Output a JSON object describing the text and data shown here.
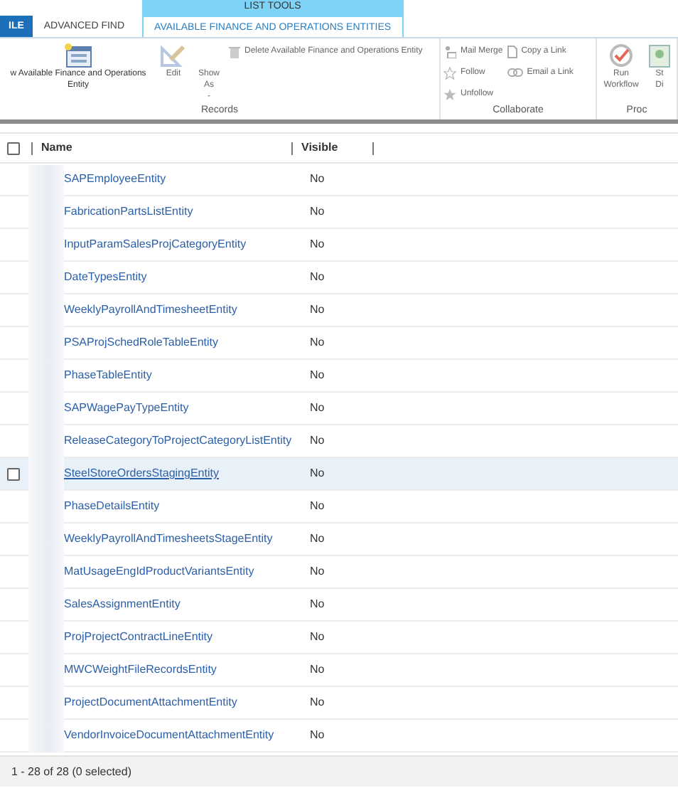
{
  "tabs": [
    {
      "label": "ILE",
      "kind": "file",
      "selected": false
    },
    {
      "label": "ADVANCED FIND",
      "kind": "tab",
      "selected": false
    },
    {
      "label": "AVAILABLE FINANCE AND OPERATIONS ENTITIES",
      "kind": "context",
      "group": "LIST TOOLS",
      "selected": true
    }
  ],
  "ribbon": {
    "groups": [
      {
        "label": "Records",
        "items": [
          {
            "kind": "large",
            "label": "w Available Finance and Operations Entity",
            "disabled": false
          },
          {
            "kind": "large",
            "label": "Edit",
            "disabled": true
          },
          {
            "kind": "large",
            "label": "Show As",
            "caret": "-",
            "disabled": true
          },
          {
            "kind": "small",
            "label": "Delete Available Finance and Operations Entity",
            "disabled": true
          }
        ]
      },
      {
        "label": "Collaborate",
        "items": [
          {
            "kind": "small",
            "label": "Mail Merge",
            "disabled": true
          },
          {
            "kind": "small",
            "label": "Follow",
            "disabled": true
          },
          {
            "kind": "small",
            "label": "Unfollow",
            "disabled": true
          },
          {
            "kind": "small",
            "label": "Copy a Link",
            "disabled": true
          },
          {
            "kind": "small",
            "label": "Email a Link",
            "disabled": true
          }
        ]
      },
      {
        "label": "Proc",
        "items": [
          {
            "kind": "large",
            "label": "Run Workflow",
            "disabled": true
          },
          {
            "kind": "large",
            "label": "St Di",
            "disabled": true
          }
        ]
      }
    ]
  },
  "table": {
    "columns": [
      "Name",
      "Visible"
    ],
    "select_all_checked": false,
    "rows": [
      {
        "name": "SAPEmployeeEntity",
        "visible": "No",
        "hovered": false
      },
      {
        "name": "FabricationPartsListEntity",
        "visible": "No",
        "hovered": false
      },
      {
        "name": "InputParamSalesProjCategoryEntity",
        "visible": "No",
        "hovered": false
      },
      {
        "name": "DateTypesEntity",
        "visible": "No",
        "hovered": false
      },
      {
        "name": "WeeklyPayrollAndTimesheetEntity",
        "visible": "No",
        "hovered": false
      },
      {
        "name": "PSAProjSchedRoleTableEntity",
        "visible": "No",
        "hovered": false
      },
      {
        "name": "PhaseTableEntity",
        "visible": "No",
        "hovered": false
      },
      {
        "name": "SAPWagePayTypeEntity",
        "visible": "No",
        "hovered": false
      },
      {
        "name": "ReleaseCategoryToProjectCategoryListEntity",
        "visible": "No",
        "hovered": false
      },
      {
        "name": "SteelStoreOrdersStagingEntity",
        "visible": "No",
        "hovered": true
      },
      {
        "name": "PhaseDetailsEntity",
        "visible": "No",
        "hovered": false
      },
      {
        "name": "WeeklyPayrollAndTimesheetsStageEntity",
        "visible": "No",
        "hovered": false
      },
      {
        "name": "MatUsageEngIdProductVariantsEntity",
        "visible": "No",
        "hovered": false
      },
      {
        "name": "SalesAssignmentEntity",
        "visible": "No",
        "hovered": false
      },
      {
        "name": "ProjProjectContractLineEntity",
        "visible": "No",
        "hovered": false
      },
      {
        "name": "MWCWeightFileRecordsEntity",
        "visible": "No",
        "hovered": false
      },
      {
        "name": "ProjectDocumentAttachmentEntity",
        "visible": "No",
        "hovered": false
      },
      {
        "name": "VendorInvoiceDocumentAttachmentEntity",
        "visible": "No",
        "hovered": false
      }
    ]
  },
  "status_bar": "1 - 28 of 28 (0 selected)"
}
